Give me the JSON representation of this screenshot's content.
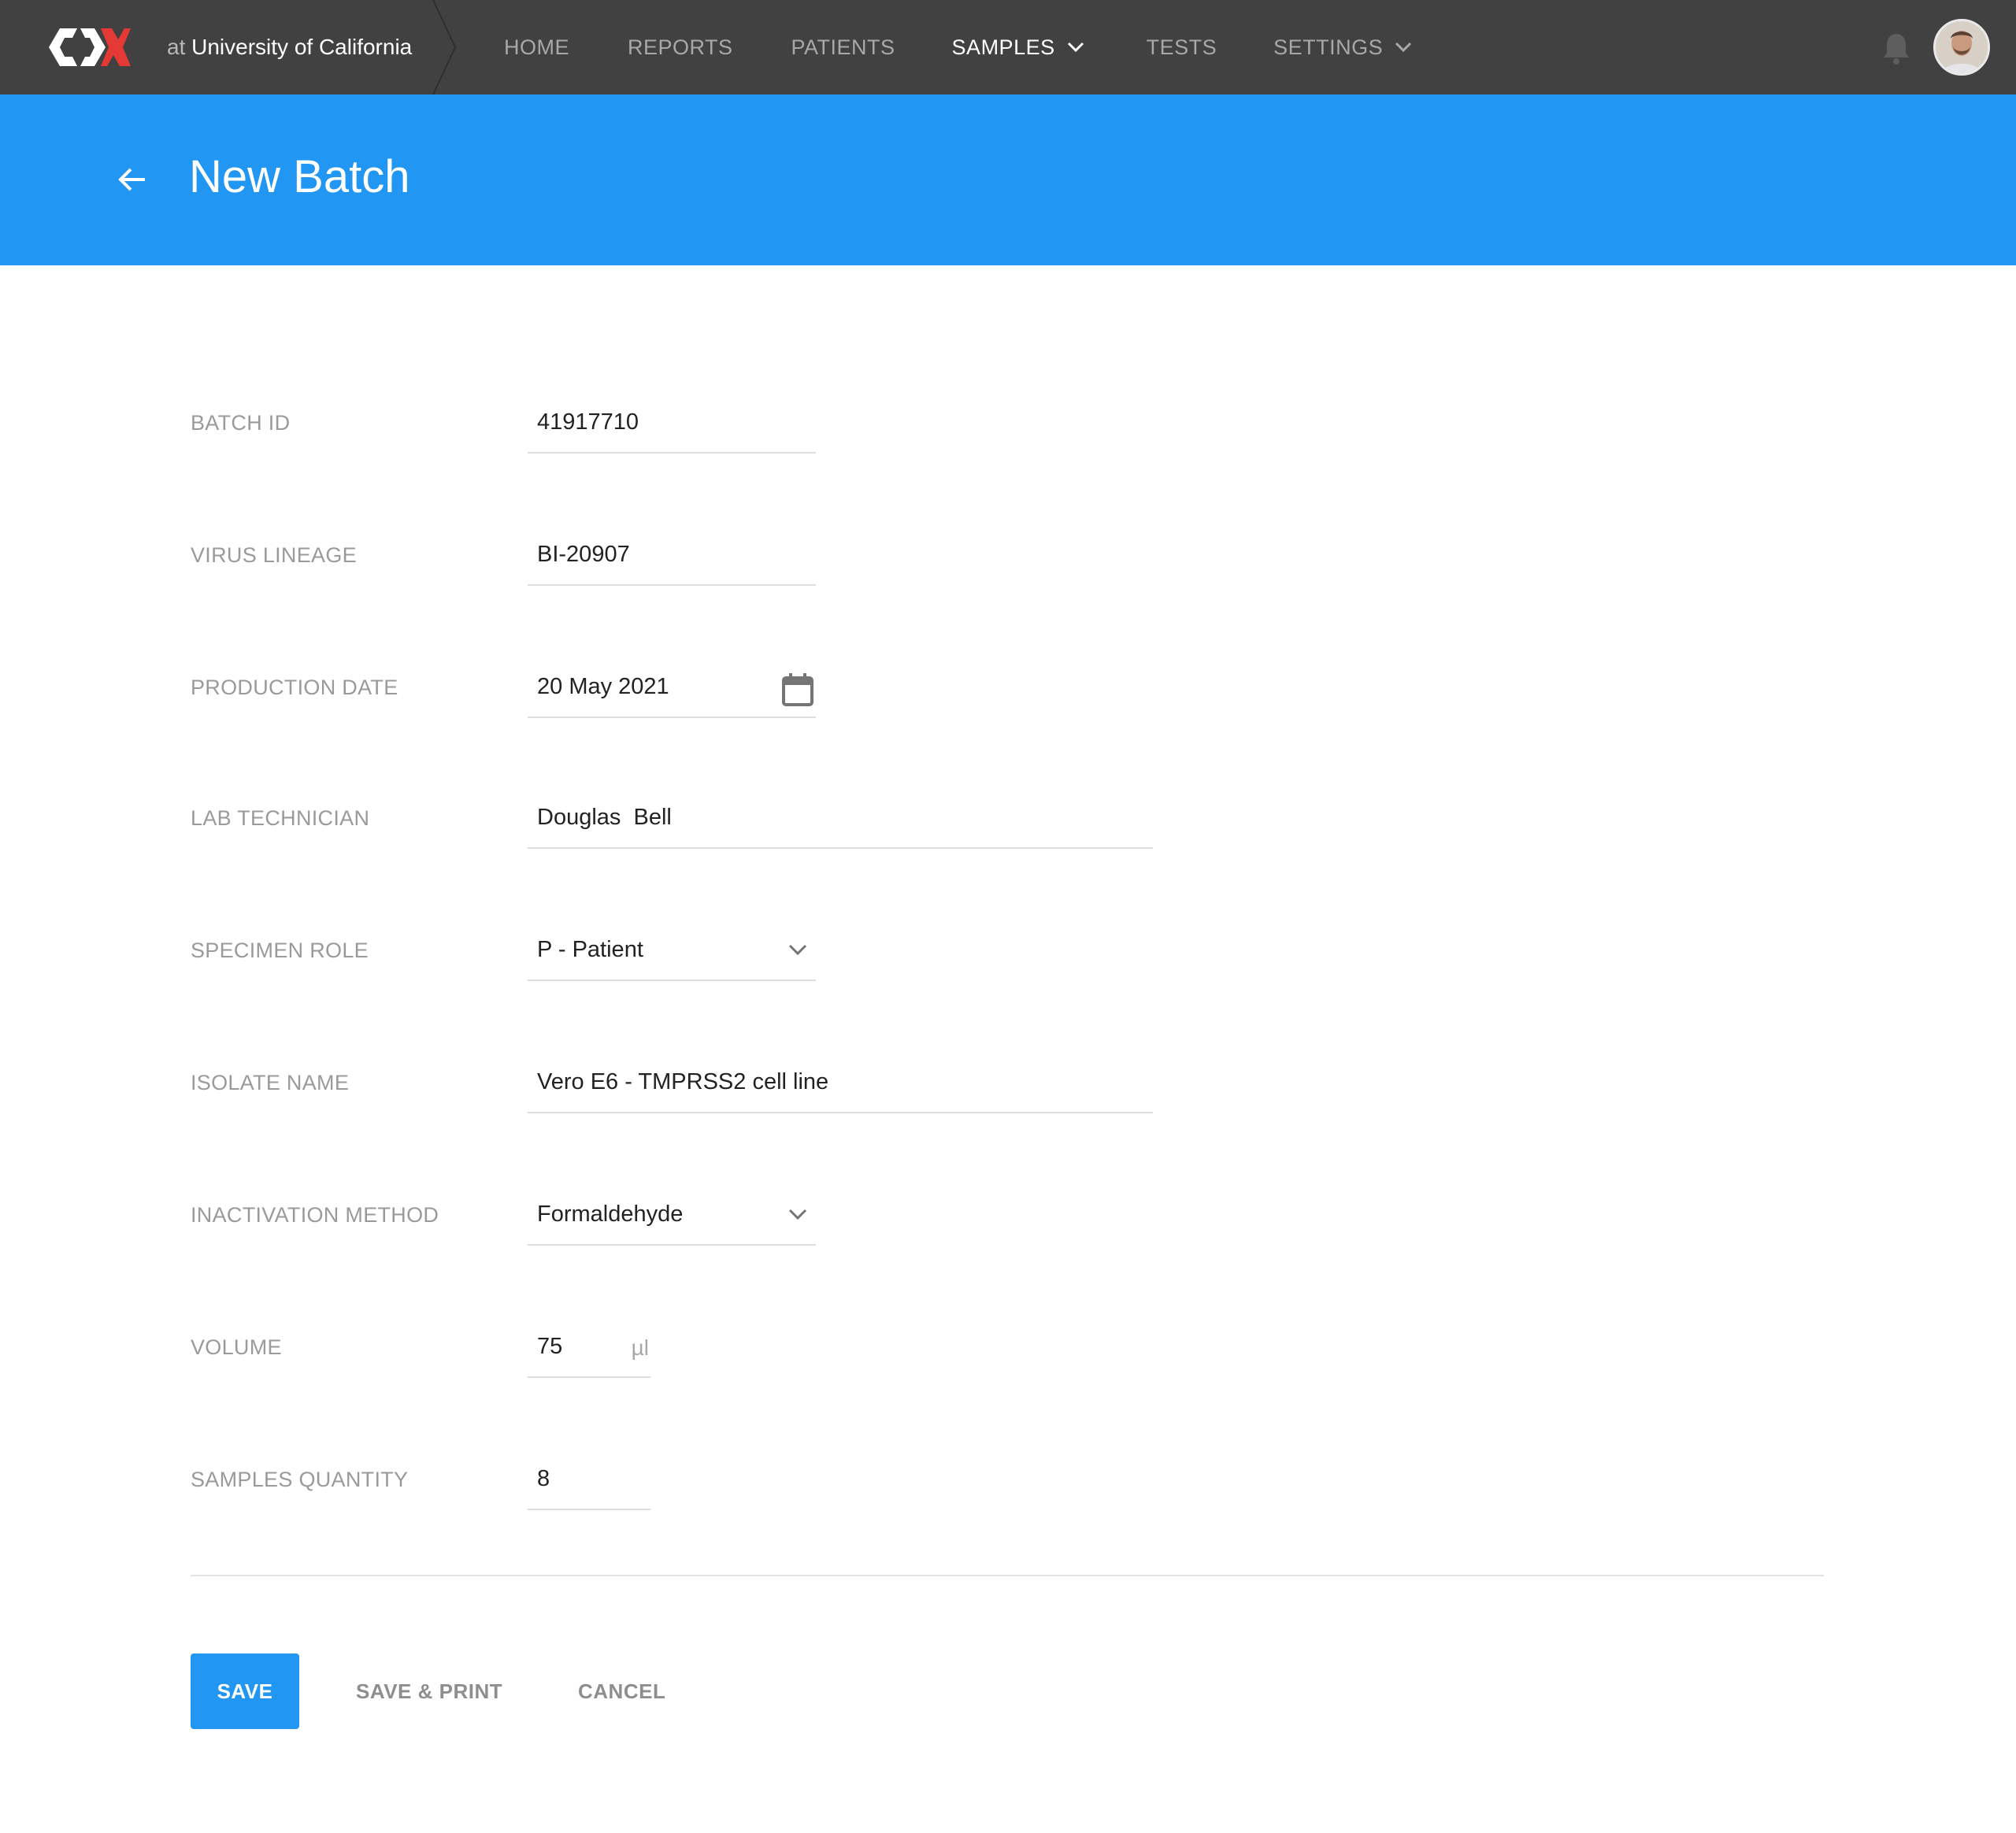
{
  "header": {
    "logo": "CDX",
    "org_prefix": "at",
    "org_name": "University of California",
    "nav": [
      {
        "label": "HOME",
        "active": false,
        "has_dropdown": false
      },
      {
        "label": "REPORTS",
        "active": false,
        "has_dropdown": false
      },
      {
        "label": "PATIENTS",
        "active": false,
        "has_dropdown": false
      },
      {
        "label": "SAMPLES",
        "active": true,
        "has_dropdown": true
      },
      {
        "label": "TESTS",
        "active": false,
        "has_dropdown": false
      },
      {
        "label": "SETTINGS",
        "active": false,
        "has_dropdown": true
      }
    ],
    "icons": {
      "notifications": "bell-icon",
      "user": "avatar"
    }
  },
  "banner": {
    "title": "New Batch",
    "back_icon": "arrow-left-icon",
    "color": "#2196f3"
  },
  "form": {
    "fields": [
      {
        "label": "BATCH ID",
        "value": "41917710",
        "type": "text"
      },
      {
        "label": "VIRUS LINEAGE",
        "value": "BI-20907",
        "type": "text"
      },
      {
        "label": "PRODUCTION DATE",
        "value": "20 May 2021",
        "type": "date",
        "icon": "calendar-icon"
      },
      {
        "label": "LAB TECHNICIAN",
        "value": "Douglas  Bell",
        "type": "text"
      },
      {
        "label": "SPECIMEN ROLE",
        "value": "P - Patient",
        "type": "select",
        "icon": "chevron-down-icon"
      },
      {
        "label": "ISOLATE NAME",
        "value": "Vero E6 - TMPRSS2 cell line",
        "type": "text"
      },
      {
        "label": "INACTIVATION METHOD",
        "value": "Formaldehyde",
        "type": "select",
        "icon": "chevron-down-icon"
      },
      {
        "label": "VOLUME",
        "value": "75",
        "unit": "µl",
        "type": "number"
      },
      {
        "label": "SAMPLES QUANTITY",
        "value": "8",
        "type": "number"
      }
    ]
  },
  "actions": {
    "save": "SAVE",
    "save_print": "SAVE & PRINT",
    "cancel": "CANCEL"
  },
  "colors": {
    "header_bg": "#414141",
    "accent": "#2196f3",
    "logo_red": "#e53935"
  }
}
